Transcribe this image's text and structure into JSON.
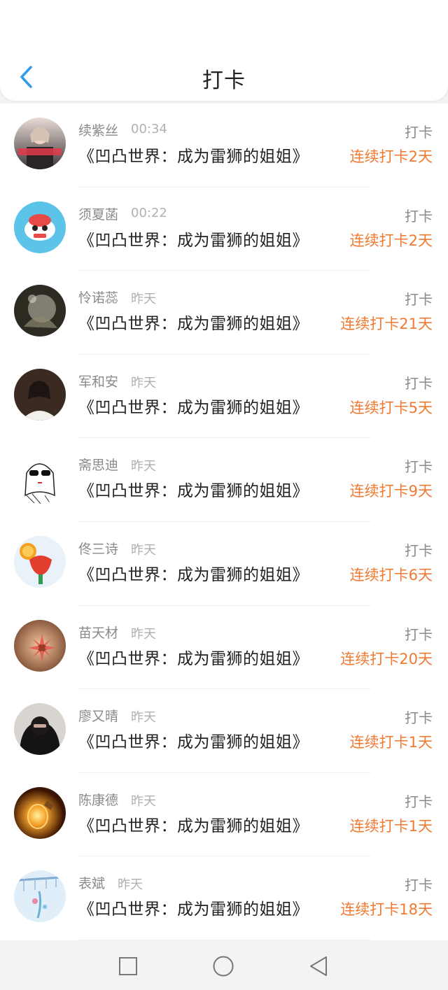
{
  "header": {
    "title": "打卡"
  },
  "rows": [
    {
      "name": "续紫丝",
      "time": "00:34",
      "book": "《凹凸世界：成为雷狮的姐姐》",
      "action": "打卡",
      "streak": "连续打卡2天"
    },
    {
      "name": "须夏菡",
      "time": "00:22",
      "book": "《凹凸世界：成为雷狮的姐姐》",
      "action": "打卡",
      "streak": "连续打卡2天"
    },
    {
      "name": "怜诺蕊",
      "time": "昨天",
      "book": "《凹凸世界：成为雷狮的姐姐》",
      "action": "打卡",
      "streak": "连续打卡21天"
    },
    {
      "name": "军和安",
      "time": "昨天",
      "book": "《凹凸世界：成为雷狮的姐姐》",
      "action": "打卡",
      "streak": "连续打卡5天"
    },
    {
      "name": "斋思迪",
      "time": "昨天",
      "book": "《凹凸世界：成为雷狮的姐姐》",
      "action": "打卡",
      "streak": "连续打卡9天"
    },
    {
      "name": "佟三诗",
      "time": "昨天",
      "book": "《凹凸世界：成为雷狮的姐姐》",
      "action": "打卡",
      "streak": "连续打卡6天"
    },
    {
      "name": "苗天材",
      "time": "昨天",
      "book": "《凹凸世界：成为雷狮的姐姐》",
      "action": "打卡",
      "streak": "连续打卡20天"
    },
    {
      "name": "廖又晴",
      "time": "昨天",
      "book": "《凹凸世界：成为雷狮的姐姐》",
      "action": "打卡",
      "streak": "连续打卡1天"
    },
    {
      "name": "陈康德",
      "time": "昨天",
      "book": "《凹凸世界：成为雷狮的姐姐》",
      "action": "打卡",
      "streak": "连续打卡1天"
    },
    {
      "name": "表斌",
      "time": "昨天",
      "book": "《凹凸世界：成为雷狮的姐姐》",
      "action": "打卡",
      "streak": "连续打卡18天"
    }
  ],
  "colors": {
    "accent": "#2f9bea",
    "streak": "#f07a32"
  },
  "icons": {
    "back": "chevron-left-icon",
    "nav": [
      "square-icon",
      "circle-icon",
      "triangle-back-icon"
    ]
  }
}
